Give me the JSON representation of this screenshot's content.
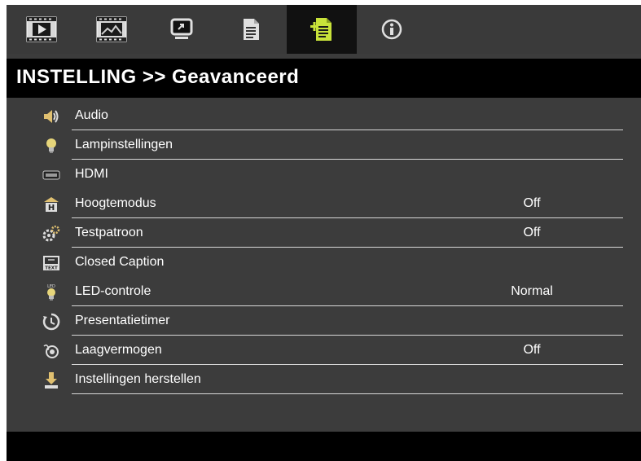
{
  "tabs": [
    {
      "icon": "video-play-icon"
    },
    {
      "icon": "picture-icon"
    },
    {
      "icon": "display-icon"
    },
    {
      "icon": "settings-document-icon"
    },
    {
      "icon": "advanced-settings-icon",
      "active": true
    },
    {
      "icon": "info-icon"
    }
  ],
  "header": {
    "title": "INSTELLING >> Geavanceerd"
  },
  "menu": {
    "items": [
      {
        "label": "Audio",
        "value": "",
        "icon": "speaker-icon"
      },
      {
        "label": "Lampinstellingen",
        "value": "",
        "icon": "lamp-icon"
      },
      {
        "label": "HDMI",
        "value": "",
        "icon": "hdmi-icon"
      },
      {
        "label": "Hoogtemodus",
        "value": "Off",
        "icon": "high-altitude-icon"
      },
      {
        "label": "Testpatroon",
        "value": "Off",
        "icon": "test-pattern-icon"
      },
      {
        "label": "Closed Caption",
        "value": "",
        "icon": "closed-caption-icon"
      },
      {
        "label": "LED-controle",
        "value": "Normal",
        "icon": "led-control-icon"
      },
      {
        "label": "Presentatietimer",
        "value": "",
        "icon": "timer-icon"
      },
      {
        "label": "Laagvermogen",
        "value": "Off",
        "icon": "low-power-icon"
      },
      {
        "label": "Instellingen herstellen",
        "value": "",
        "icon": "reset-icon"
      }
    ],
    "icon_text": {
      "led": "LED",
      "text": "TEXT",
      "high": "H"
    }
  },
  "colors": {
    "background": "#3c3c3c",
    "bar": "#000000",
    "active_tab_icon": "#c8e23a",
    "text": "#ffffff"
  }
}
